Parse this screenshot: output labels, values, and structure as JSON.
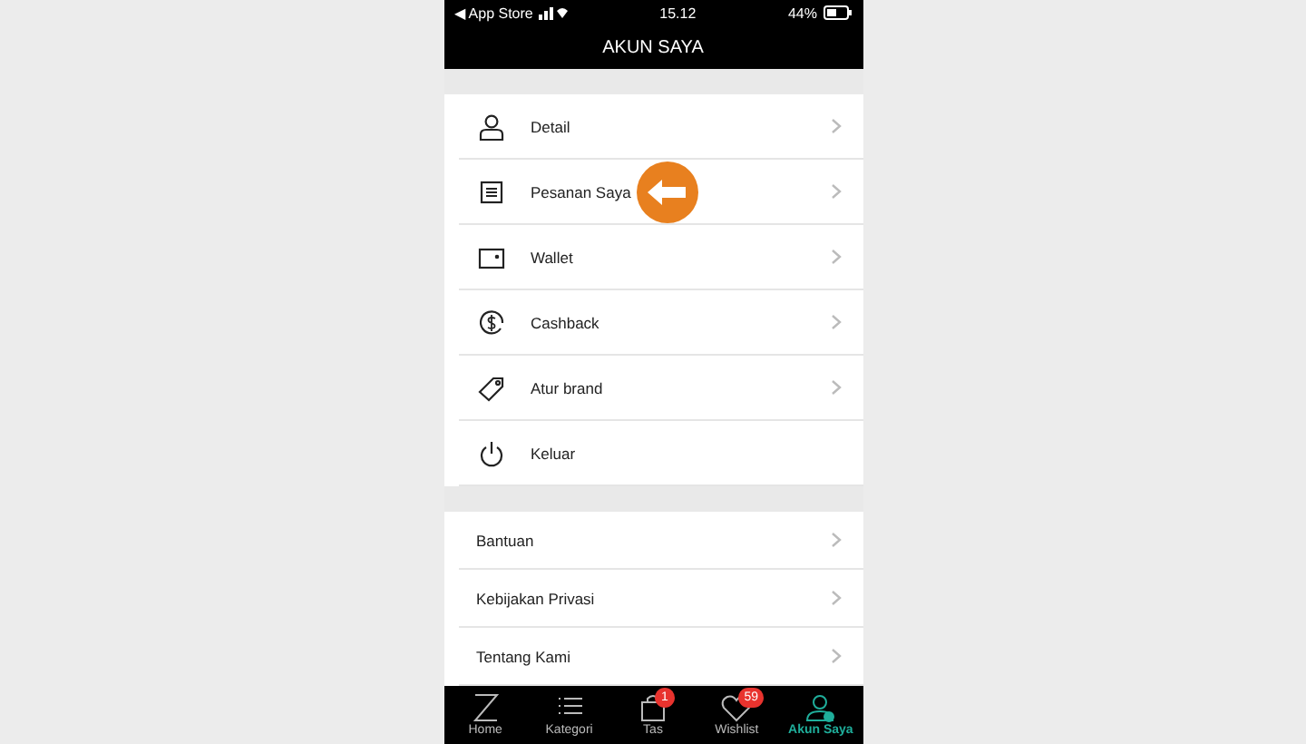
{
  "status_bar": {
    "carrier": "◀ App Store",
    "time": "15.12",
    "battery": "44%"
  },
  "header": {
    "title": "AKUN SAYA"
  },
  "menu": [
    {
      "kind": "person",
      "label": "Detail",
      "chevron": true
    },
    {
      "kind": "list",
      "label": "Pesanan Saya",
      "chevron": true
    },
    {
      "kind": "wallet",
      "label": "Wallet",
      "chevron": true
    },
    {
      "kind": "cashback",
      "label": "Cashback",
      "chevron": true
    },
    {
      "kind": "tag",
      "label": "Atur brand",
      "chevron": true
    },
    {
      "kind": "power",
      "label": "Keluar",
      "chevron": false
    }
  ],
  "info": [
    {
      "label": "Bantuan",
      "chevron": true
    },
    {
      "label": "Kebijakan Privasi",
      "chevron": true
    },
    {
      "label": "Tentang Kami",
      "chevron": true
    }
  ],
  "tab_bar": [
    {
      "kind": "home",
      "label": "Home",
      "selected": false
    },
    {
      "kind": "list",
      "label": "Kategori",
      "selected": false
    },
    {
      "kind": "bag",
      "label": "Tas",
      "badge": "1",
      "selected": false
    },
    {
      "kind": "heart",
      "label": "Wishlist",
      "badge": "59",
      "selected": false
    },
    {
      "kind": "person",
      "label": "Akun Saya",
      "selected": true
    }
  ]
}
